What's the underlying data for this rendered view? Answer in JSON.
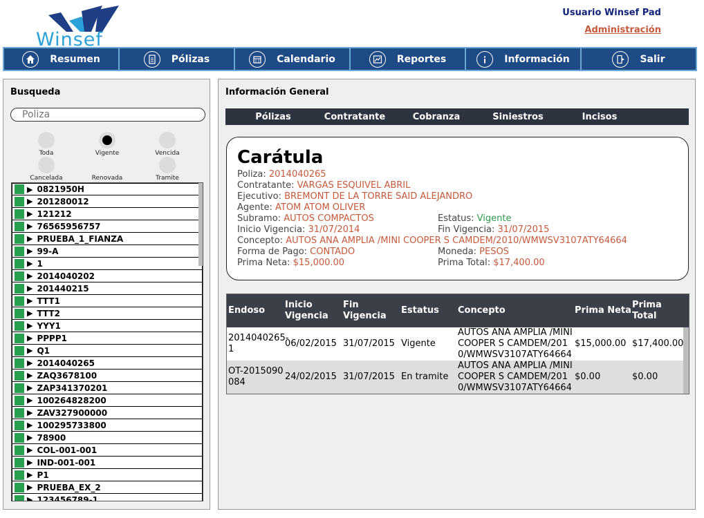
{
  "header": {
    "logo_text": "Winsef",
    "user_name": "Usuario Winsef Pad",
    "admin_link": "Administración"
  },
  "nav": [
    {
      "label": "Resumen",
      "icon": "home-icon"
    },
    {
      "label": "Pólizas",
      "icon": "document-icon"
    },
    {
      "label": "Calendario",
      "icon": "calendar-icon"
    },
    {
      "label": "Reportes",
      "icon": "chart-icon"
    },
    {
      "label": "Información",
      "icon": "info-icon"
    },
    {
      "label": "Salir",
      "icon": "exit-icon"
    }
  ],
  "search": {
    "title": "Busqueda",
    "placeholder": "Poliza",
    "filters": [
      {
        "label": "Toda",
        "selected": false
      },
      {
        "label": "Vigente",
        "selected": true
      },
      {
        "label": "Vencida",
        "selected": false
      },
      {
        "label": "Cancelada",
        "selected": false
      },
      {
        "label": "Renovada",
        "selected": false
      },
      {
        "label": "Tramite",
        "selected": false
      }
    ],
    "results": [
      "0821950H",
      "201280012",
      "121212",
      "76565956757",
      "PRUEBA_1_FIANZA",
      "99-A",
      "1",
      "2014040202",
      "201440215",
      "TTT1",
      "TTT2",
      "YYY1",
      "PPPP1",
      "Q1",
      "2014040265",
      "ZAQ3678100",
      "ZAP341370201",
      "100264828200",
      "ZAV327900000",
      "100295733800",
      "78900",
      "COL-001-001",
      "IND-001-001",
      "P1",
      "PRUEBA_EX_2",
      "123456789-1"
    ]
  },
  "info": {
    "title": "Información General",
    "tabs": [
      "Pólizas",
      "Contratante",
      "Cobranza",
      "Siniestros",
      "Incisos"
    ],
    "card": {
      "title": "Carátula",
      "poliza_k": "Poliza: ",
      "poliza_v": "2014040265",
      "contratante_k": "Contratante: ",
      "contratante_v": "VARGAS ESQUIVEL ABRIL",
      "ejecutivo_k": "Ejecutivo: ",
      "ejecutivo_v": "BREMONT DE LA TORRE SAID ALEJANDRO",
      "agente_k": "Agente: ",
      "agente_v": "ATOM ATOM OLIVER",
      "subramo_k": "Subramo: ",
      "subramo_v": "AUTOS COMPACTOS",
      "estatus_k": "Estatus: ",
      "estatus_v": "Vigente",
      "inicio_k": "Inicio Vigencia: ",
      "inicio_v": "31/07/2014",
      "fin_k": "Fin Vigencia: ",
      "fin_v": "31/07/2015",
      "concepto_k": "Concepto: ",
      "concepto_v": "AUTOS ANA AMPLIA /MINI COOPER S CAMDEM/2010/WMWSV3107ATY64664",
      "forma_k": "Forma de Pago: ",
      "forma_v": "CONTADO",
      "moneda_k": "Moneda: ",
      "moneda_v": "PESOS",
      "neta_k": "Prima Neta: ",
      "neta_v": "$15,000.00",
      "total_k": "Prima Total: ",
      "total_v": "$17,400.00"
    },
    "table": {
      "headers": {
        "endoso": "Endoso",
        "inicio": "Inicio Vigencia",
        "fin": "Fin Vigencia",
        "estatus": "Estatus",
        "concepto": "Concepto",
        "neta": "Prima Neta",
        "total": "Prima Total"
      },
      "rows": [
        {
          "endoso": "2014040265-1",
          "inicio": "06/02/2015",
          "fin": "31/07/2015",
          "estatus": "Vigente",
          "concepto": "AUTOS ANA AMPLIA /MINI COOPER S CAMDEM/2010/WMWSV3107ATY64664",
          "neta": "$15,000.00",
          "total": "$17,400.00"
        },
        {
          "endoso": "OT-2015090084",
          "inicio": "24/02/2015",
          "fin": "31/07/2015",
          "estatus": "En tramite",
          "concepto": "AUTOS ANA AMPLIA /MINI COOPER S CAMDEM/2010/WMWSV3107ATY64664",
          "neta": "$0.00",
          "total": "$0.00"
        }
      ]
    }
  }
}
